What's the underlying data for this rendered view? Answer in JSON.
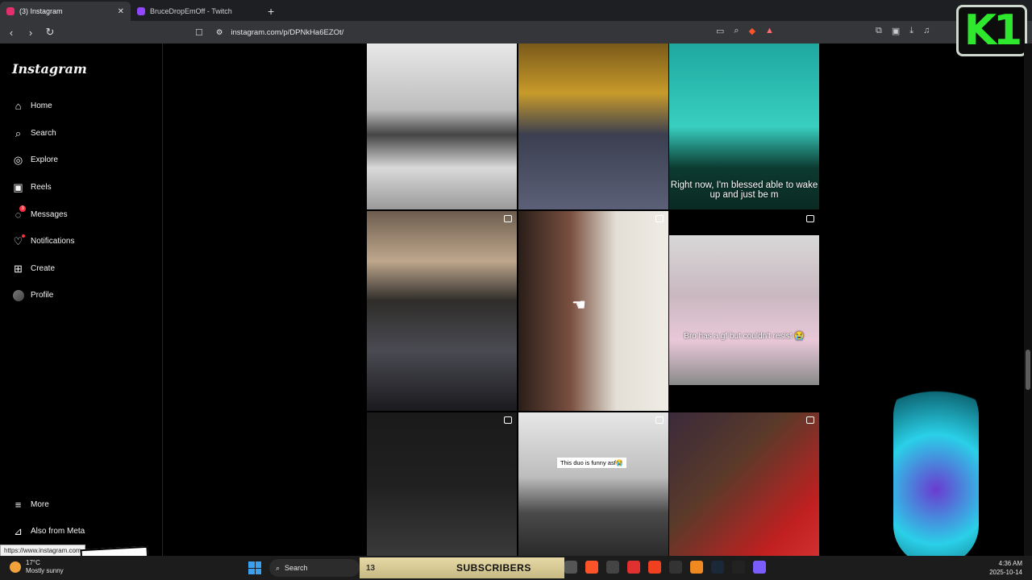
{
  "browser": {
    "tabs": [
      {
        "title": "(3) Instagram",
        "active": true,
        "color": "#e1306c"
      },
      {
        "title": "BruceDropEmOff - Twitch",
        "active": false,
        "color": "#9146ff"
      }
    ],
    "url": "instagram.com/p/DPNkHa6EZOt/",
    "status_url": "https://www.instagram.com"
  },
  "overlay": {
    "logo_text": "K1"
  },
  "sidebar": {
    "logo": "Instagram",
    "items": [
      {
        "label": "Home",
        "icon": "home-icon"
      },
      {
        "label": "Search",
        "icon": "search-icon"
      },
      {
        "label": "Explore",
        "icon": "compass-icon"
      },
      {
        "label": "Reels",
        "icon": "reels-icon"
      },
      {
        "label": "Messages",
        "icon": "messenger-icon",
        "badge": "3"
      },
      {
        "label": "Notifications",
        "icon": "heart-icon"
      },
      {
        "label": "Create",
        "icon": "plus-square-icon"
      },
      {
        "label": "Profile",
        "icon": "avatar"
      }
    ],
    "more": "More",
    "meta": "Also from Meta"
  },
  "grid": {
    "captions": {
      "c3": "Right now, I'm blessed able to wake up and just be m",
      "c6": "Bro has a gf but couldn't resist 😭",
      "c8": "This duo is funny asf😭"
    }
  },
  "taskbar": {
    "weather_temp": "17°C",
    "weather_desc": "Mostly sunny",
    "search": "Search",
    "subscriber_count": "13",
    "subscribers_label": "SUBSCRIBERS",
    "time": "4:36 AM",
    "date": "2025-10-14"
  },
  "colors": {
    "accent_green": "#2ee82e",
    "notification_red": "#ff3040"
  }
}
